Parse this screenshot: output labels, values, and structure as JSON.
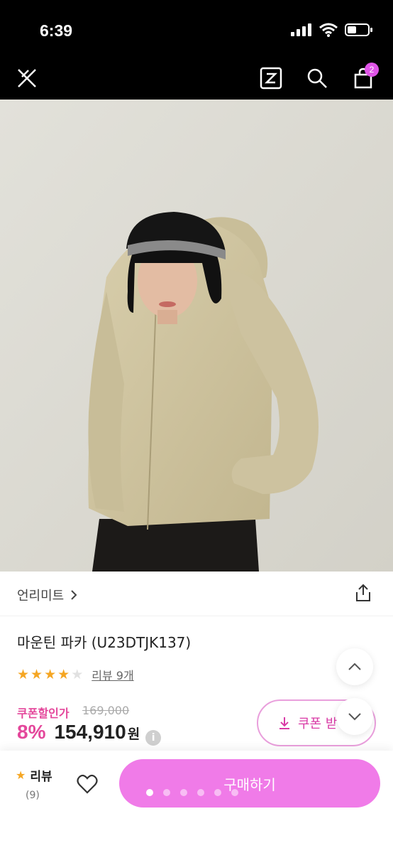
{
  "status_bar": {
    "time": "6:39"
  },
  "nav": {
    "cart_count": "2"
  },
  "hero": {
    "image_alt": "model wearing beige hooded parka"
  },
  "product": {
    "brand": "언리미트",
    "name": "마운틴 파카 (U23DTJK137)",
    "rating": 4,
    "rating_max": 5,
    "review_link": "리뷰 9개",
    "coupon_label": "쿠폰할인가",
    "original_price": "169,000",
    "discount": "8%",
    "price": "154,910",
    "currency": "원",
    "coupon_button": "쿠폰 받"
  },
  "bottom_bar": {
    "review_label": "리뷰",
    "review_count": "(9)",
    "buy_label": "구매하기",
    "pagination": {
      "total": 6,
      "active": 1
    }
  },
  "colors": {
    "accent_pink": "#e4479b",
    "buy_button": "#f07be8",
    "star": "#f5a623"
  }
}
